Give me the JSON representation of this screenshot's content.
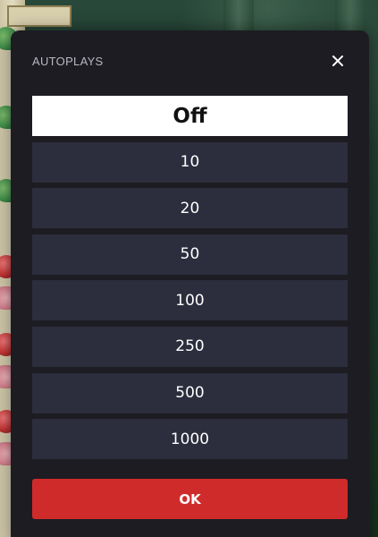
{
  "modal": {
    "title": "AUTOPLAYS",
    "close_icon": "close-icon",
    "options": [
      {
        "label": "Off",
        "selected": true
      },
      {
        "label": "10",
        "selected": false
      },
      {
        "label": "20",
        "selected": false
      },
      {
        "label": "50",
        "selected": false
      },
      {
        "label": "100",
        "selected": false
      },
      {
        "label": "250",
        "selected": false
      },
      {
        "label": "500",
        "selected": false
      },
      {
        "label": "1000",
        "selected": false
      }
    ],
    "ok_label": "OK"
  },
  "colors": {
    "modal_background": "#1d1c22",
    "option_background": "#2c2d3d",
    "selected_background": "#ffffff",
    "ok_button": "#d02b2b"
  }
}
